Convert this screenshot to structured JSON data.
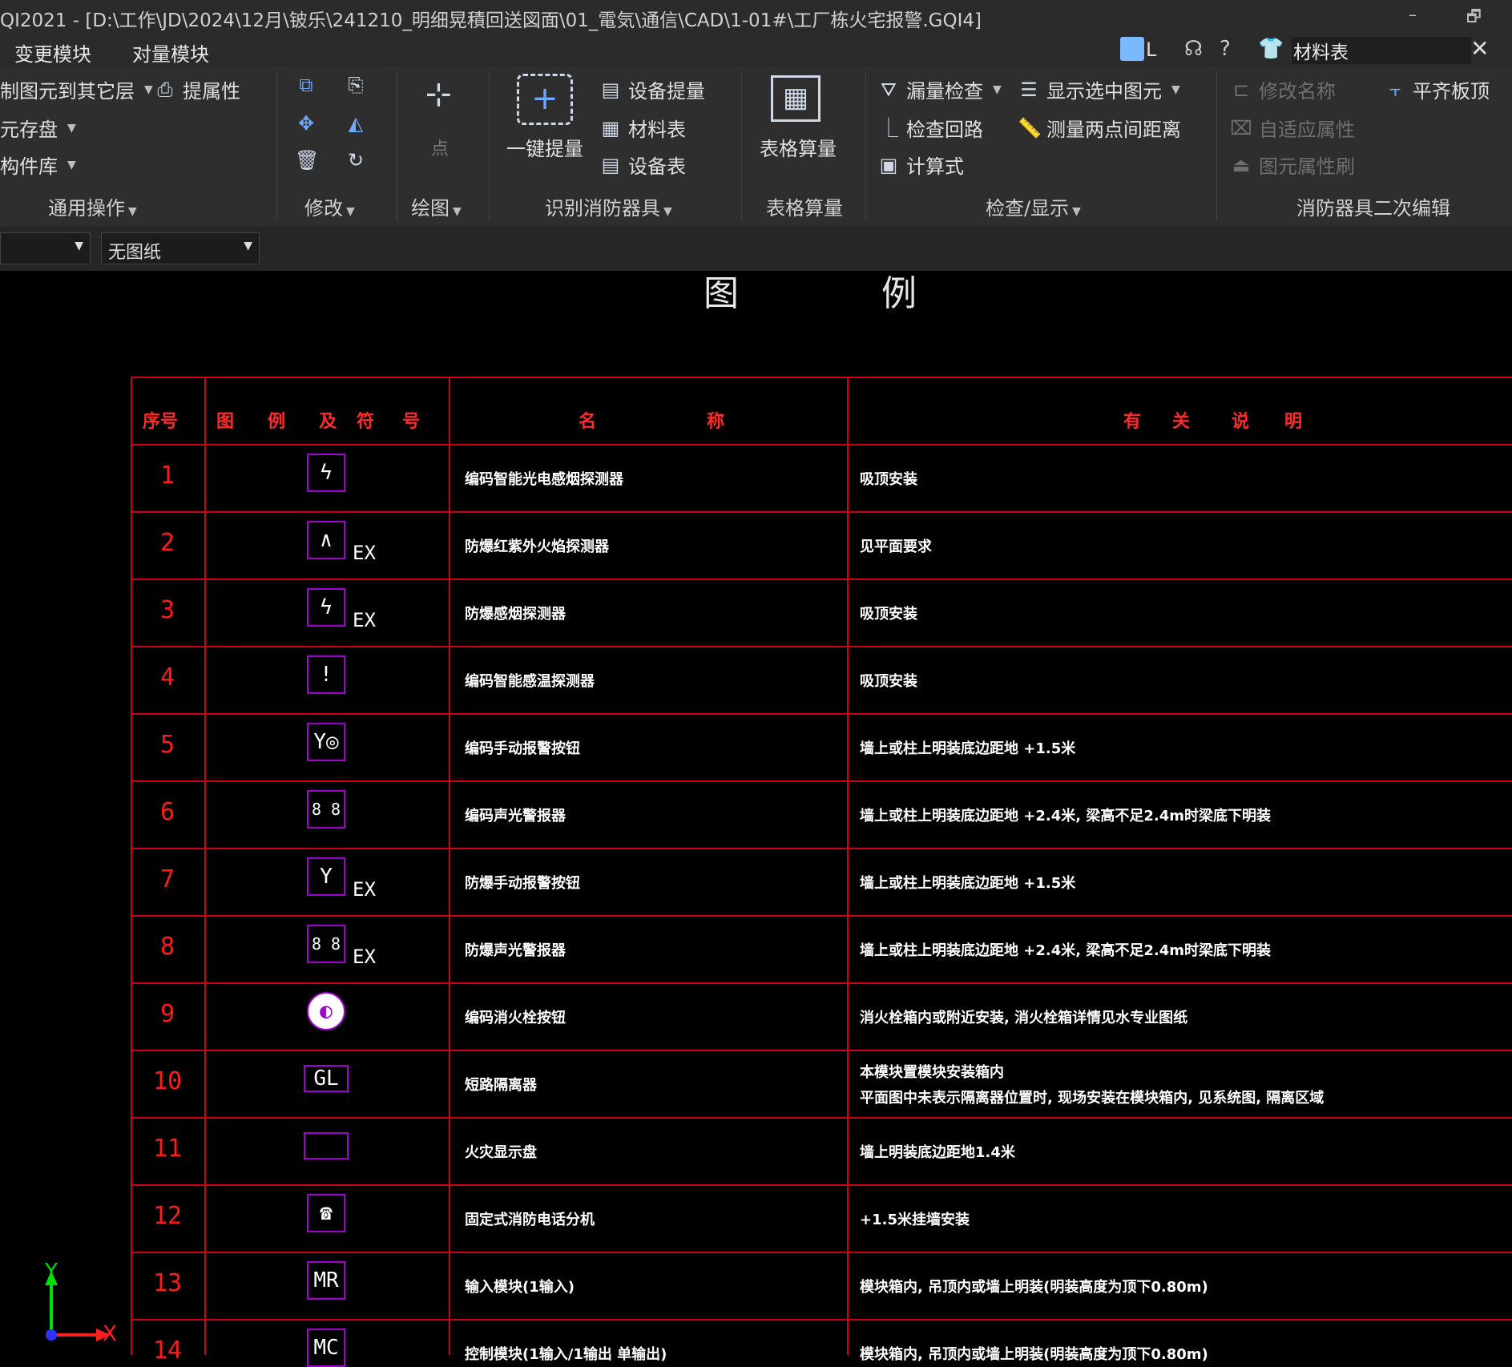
{
  "window": {
    "title": "QI2021 - [D:\\工作\\JD\\2024\\12月\\铍乐\\241210_明细晃積回送図面\\01_電気\\通信\\CAD\\1-01#\\工厂栋火宅报警.GQI4]",
    "minimize": "–",
    "restore": "🗗"
  },
  "menubar": {
    "items": [
      "变更模块",
      "对量模块"
    ],
    "user_initial": "L",
    "help": "?",
    "search_value": "材料表"
  },
  "ribbon": {
    "general": {
      "item1": "制图元到其它层",
      "item2": "元存盘",
      "item3": "构件库",
      "item4": "提属性",
      "group": "通用操作"
    },
    "modify": {
      "group": "修改"
    },
    "draw": {
      "point": "点",
      "group": "绘图"
    },
    "identify": {
      "one_click": "一键提量",
      "equip_extract": "设备提量",
      "material_table": "材料表",
      "equip_table": "设备表",
      "group": "识别消防器具"
    },
    "table_calc": {
      "label": "表格算量",
      "group": "表格算量"
    },
    "check": {
      "leak_check": "漏量检查",
      "check_loop": "检查回路",
      "formula": "计算式",
      "show_selected": "显示选中图元",
      "measure": "测量两点间距离",
      "group": "检查/显示"
    },
    "secondary": {
      "rename": "修改名称",
      "adaptive": "自适应属性",
      "brush": "图元属性刷",
      "align_top": "平齐板顶",
      "group": "消防器具二次编辑"
    }
  },
  "toolbar2": {
    "drawing_select": "无图纸"
  },
  "cad": {
    "title_left": "图",
    "title_right": "例",
    "headers": {
      "seq": "序号",
      "symbol": [
        "图",
        "例",
        "及",
        "符",
        "号"
      ],
      "name": [
        "名",
        "称"
      ],
      "desc": [
        "有",
        "关",
        "说",
        "明"
      ]
    },
    "rows": [
      {
        "no": "1",
        "sym": "ϟ",
        "ex": "",
        "name": "编码智能光电感烟探测器",
        "desc": "吸顶安装"
      },
      {
        "no": "2",
        "sym": "∧",
        "ex": "EX",
        "name": "防爆红紫外火焰探测器",
        "desc": "见平面要求"
      },
      {
        "no": "3",
        "sym": "ϟ",
        "ex": "EX",
        "name": "防爆感烟探测器",
        "desc": "吸顶安装"
      },
      {
        "no": "4",
        "sym": "ǃ",
        "ex": "",
        "name": "编码智能感温探测器",
        "desc": "吸顶安装"
      },
      {
        "no": "5",
        "sym": "Y◎",
        "ex": "",
        "name": "编码手动报警按钮",
        "desc": "墙上或柱上明装底边距地 +1.5米"
      },
      {
        "no": "6",
        "sym": "8 8",
        "ex": "",
        "name": "编码声光警报器",
        "desc": "墙上或柱上明装底边距地 +2.4米, 梁高不足2.4m时梁底下明装"
      },
      {
        "no": "7",
        "sym": "Y",
        "ex": "EX",
        "name": "防爆手动报警按钮",
        "desc": "墙上或柱上明装底边距地 +1.5米"
      },
      {
        "no": "8",
        "sym": "8 8",
        "ex": "EX",
        "name": "防爆声光警报器",
        "desc": "墙上或柱上明装底边距地 +2.4米, 梁高不足2.4m时梁底下明装"
      },
      {
        "no": "9",
        "sym": "◐",
        "ex": "",
        "name": "编码消火栓按钮",
        "desc": "消火栓箱内或附近安装, 消火栓箱详情见水专业图纸"
      },
      {
        "no": "10",
        "sym": "GL",
        "ex": "",
        "name": "短路隔离器",
        "desc": "本模块置模块安装箱内",
        "desc2": "平面图中未表示隔离器位置时, 现场安装在模块箱内, 见系统图, 隔离区域"
      },
      {
        "no": "11",
        "sym": "",
        "ex": "",
        "name": "火灾显示盘",
        "desc": "墙上明装底边距地1.4米"
      },
      {
        "no": "12",
        "sym": "☎",
        "ex": "",
        "name": "固定式消防电话分机",
        "desc": "+1.5米挂墙安装"
      },
      {
        "no": "13",
        "sym": "MR",
        "ex": "",
        "name": "输入模块(1输入)",
        "desc": "模块箱内, 吊顶内或墙上明装(明装高度为顶下0.80m)"
      },
      {
        "no": "14",
        "sym": "MC",
        "ex": "",
        "name": "控制模块(1输入/1输出 单输出)",
        "desc": "模块箱内, 吊顶内或墙上明装(明装高度为顶下0.80m)"
      }
    ]
  },
  "axes": {
    "x": "X",
    "y": "Y"
  },
  "colors": {
    "grid": "#d0001c",
    "symbol": "#a000d0",
    "number": "#ff1a1a"
  }
}
